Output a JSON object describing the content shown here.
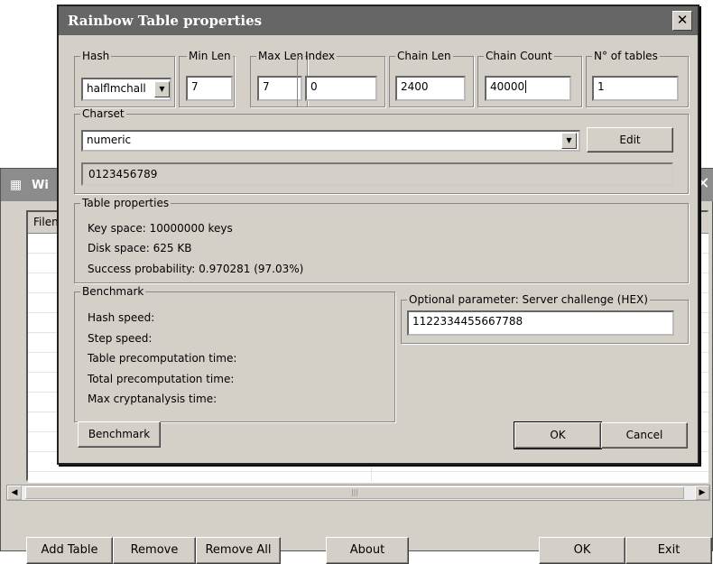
{
  "background_window": {
    "title": "Wi",
    "list_header": "Filen",
    "scroll_thumb_grip": "|||",
    "buttons": {
      "add_table": "Add Table",
      "remove": "Remove",
      "remove_all": "Remove All",
      "about": "About",
      "ok": "OK",
      "exit": "Exit"
    }
  },
  "dialog": {
    "title": "Rainbow Table properties",
    "fields": {
      "hash": {
        "legend": "Hash",
        "value": "halflmchall"
      },
      "min_len": {
        "legend": "Min Len",
        "value": "7"
      },
      "max_len": {
        "legend": "Max Len",
        "value": "7"
      },
      "index": {
        "legend": "Index",
        "value": "0"
      },
      "chain_len": {
        "legend": "Chain Len",
        "value": "2400"
      },
      "chain_count": {
        "legend": "Chain Count",
        "value": "40000"
      },
      "num_tables": {
        "legend": "N° of tables",
        "value": "1"
      }
    },
    "charset": {
      "legend": "Charset",
      "selected": "numeric",
      "edit_label": "Edit",
      "chars": "0123456789"
    },
    "table_properties": {
      "legend": "Table properties",
      "key_space": "Key space: 10000000 keys",
      "disk_space": "Disk space: 625 KB",
      "success_probability": "Success probability: 0.970281 (97.03%)"
    },
    "benchmark": {
      "legend": "Benchmark",
      "hash_speed": "Hash speed:",
      "step_speed": "Step speed:",
      "table_precomputation_time": "Table precomputation time:",
      "total_precomputation_time": "Total precomputation time:",
      "max_cryptanalysis_time": "Max cryptanalysis time:",
      "button_label": "Benchmark"
    },
    "optional_parameter": {
      "legend": "Optional parameter: Server challenge (HEX)",
      "value": "1122334455667788"
    },
    "buttons": {
      "ok": "OK",
      "cancel": "Cancel"
    }
  }
}
